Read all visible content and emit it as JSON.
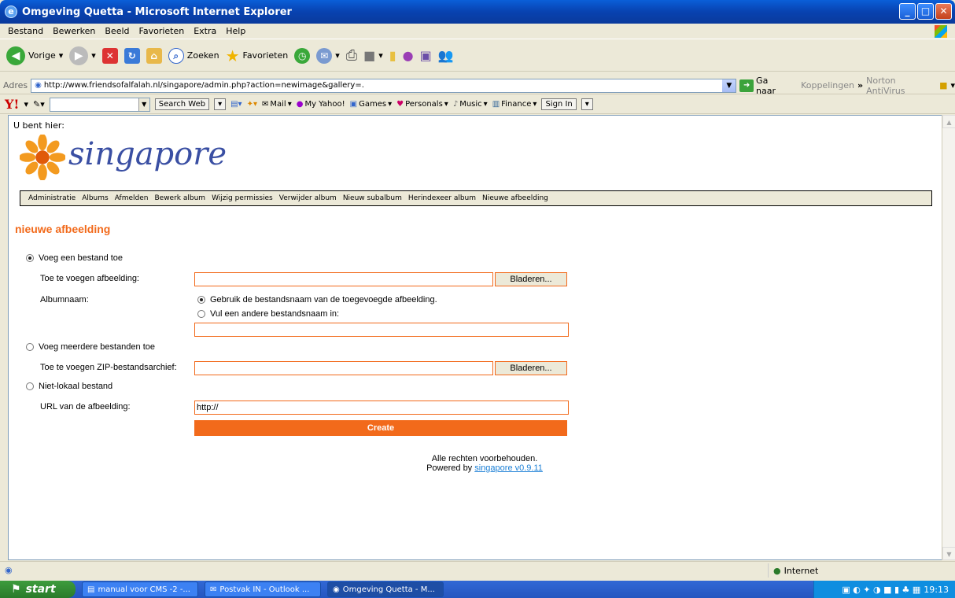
{
  "window": {
    "title": "Omgeving Quetta - Microsoft Internet Explorer"
  },
  "menu": [
    "Bestand",
    "Bewerken",
    "Beeld",
    "Favorieten",
    "Extra",
    "Help"
  ],
  "toolbar": {
    "back": "Vorige",
    "search": "Zoeken",
    "favorites": "Favorieten"
  },
  "address": {
    "label": "Adres",
    "url": "http://www.friendsofalfalah.nl/singapore/admin.php?action=newimage&gallery=.",
    "go": "Ga naar",
    "links": "Koppelingen",
    "norton": "Norton AntiVirus"
  },
  "yahoo": {
    "search_btn": "Search Web",
    "items": [
      "Mail",
      "My Yahoo!",
      "Games",
      "Personals",
      "Music",
      "Finance"
    ],
    "signin": "Sign In"
  },
  "page": {
    "you_are_here": "U bent hier:",
    "logo_text": "singapore",
    "nav": [
      "Administratie",
      "Albums",
      "Afmelden",
      "Bewerk album",
      "Wijzig permissies",
      "Verwijder album",
      "Nieuw subalbum",
      "Herindexeer album",
      "Nieuwe afbeelding"
    ],
    "heading": "nieuwe afbeelding",
    "opt_single": "Voeg een bestand toe",
    "lbl_image": "Toe te voegen afbeelding:",
    "browse": "Bladeren...",
    "lbl_albumname": "Albumnaam:",
    "opt_use_filename": "Gebruik de bestandsnaam van de toegevoegde afbeelding.",
    "opt_other_filename": "Vul een andere bestandsnaam in:",
    "opt_multi": "Voeg meerdere bestanden toe",
    "lbl_zip": "Toe te voegen ZIP-bestandsarchief:",
    "opt_remote": "Niet-lokaal bestand",
    "lbl_url": "URL van de afbeelding:",
    "url_value": "http://",
    "create": "Create",
    "footer_line1": "Alle rechten voorbehouden.",
    "footer_powered": "Powered by",
    "footer_link": "singapore v0.9.11"
  },
  "status": {
    "zone": "Internet"
  },
  "taskbar": {
    "start": "start",
    "tasks": [
      "manual voor CMS -2 -...",
      "Postvak IN - Outlook ...",
      "Omgeving Quetta - M..."
    ],
    "clock": "19:13"
  }
}
